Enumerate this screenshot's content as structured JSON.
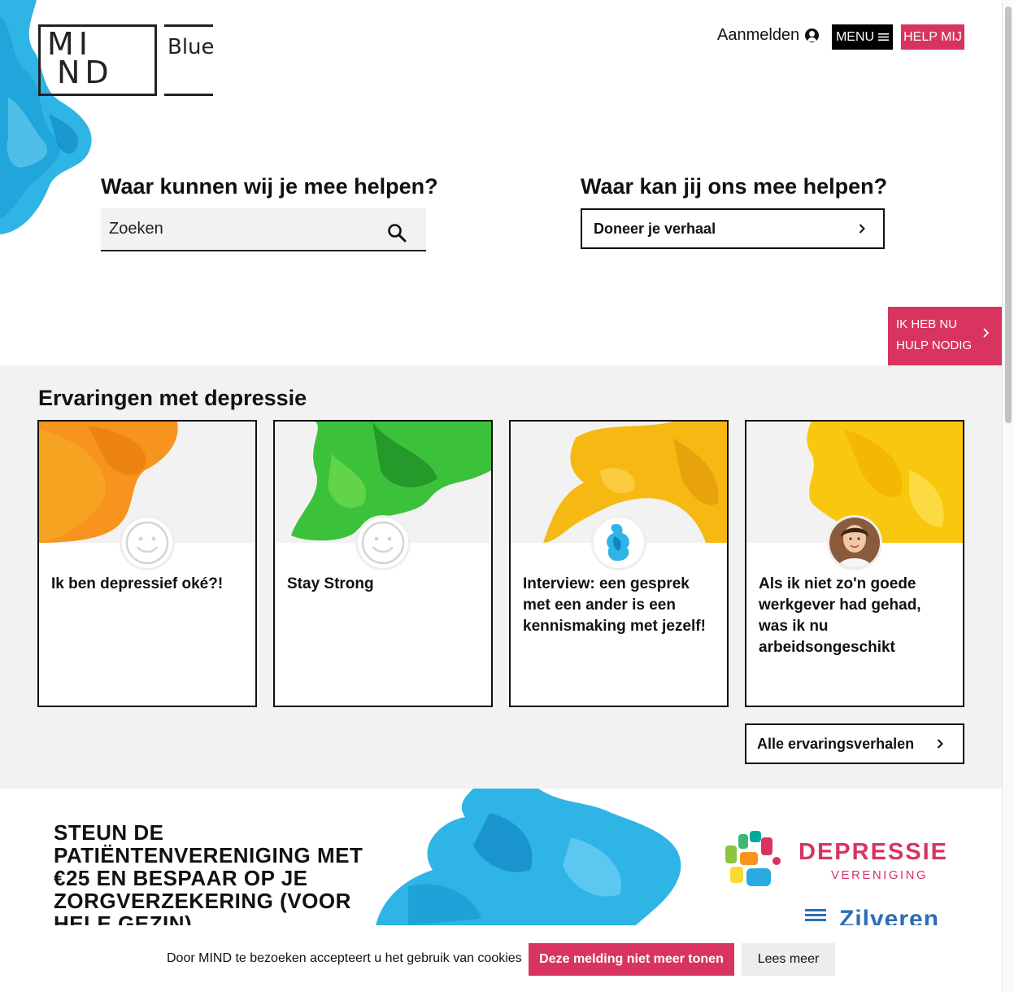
{
  "logo": {
    "mind": "MI ND",
    "mind_line1": "MI",
    "mind_line2": "ND",
    "blue": "Blue"
  },
  "header": {
    "login_label": "Aanmelden",
    "menu_label": "MENU",
    "help_label": "HELP MIJ"
  },
  "search_section": {
    "heading": "Waar kunnen wij je mee helpen?",
    "placeholder": "Zoeken"
  },
  "donate_section": {
    "heading": "Waar kan jij ons mee helpen?",
    "button_label": "Doneer je verhaal"
  },
  "help_now": {
    "line1": "IK HEB NU",
    "line2": "HULP NODIG"
  },
  "stories": {
    "heading": "Ervaringen met depressie",
    "cards": [
      {
        "title": "Ik ben depressief oké?!",
        "color": "#f7941d",
        "avatar": "smiley-icon"
      },
      {
        "title": "Stay Strong",
        "color": "#3cc23a",
        "avatar": "smiley-icon"
      },
      {
        "title": "Interview: een gesprek met een ander is een kennismaking met jezelf!",
        "color": "#f6b914",
        "avatar": "blue-ink-avatar"
      },
      {
        "title": "Als ik niet zo'n goede werkgever had gehad, was ik nu arbeidsongeschikt",
        "color": "#f9c80e",
        "avatar": "person-photo"
      }
    ],
    "all_label": "Alle ervaringsverhalen"
  },
  "banner": {
    "text": "STEUN DE PATIËNTENVERENIGING MET €25 EN BESPAAR OP JE ZORGVERZEKERING (VOOR HELE GEZIN)",
    "partner_name": "DEPRESSIE",
    "partner_sub": "VERENIGING",
    "insurer": "Zilveren"
  },
  "cookie": {
    "text": "Door MIND te bezoeken accepteert u het gebruik van cookies",
    "accept_label": "Deze melding niet meer tonen",
    "more_label": "Lees meer"
  },
  "colors": {
    "accent": "#d8345f",
    "ink_blue": "#2fb4e6",
    "panel": "#f2f2f2"
  }
}
